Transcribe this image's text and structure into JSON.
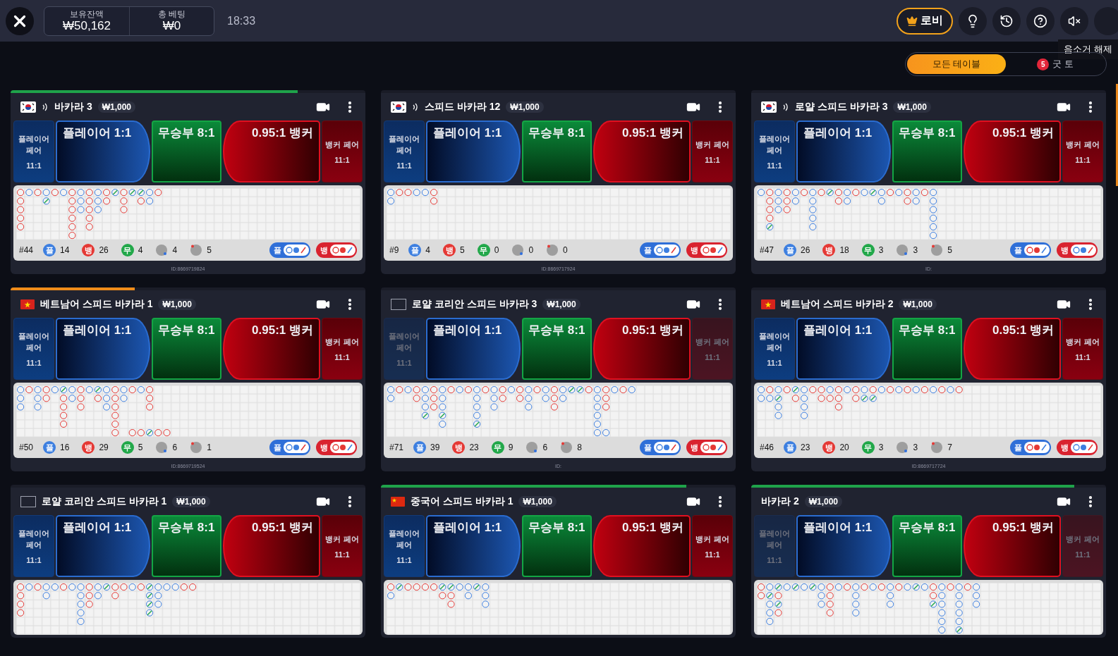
{
  "top_bar": {
    "balance": {
      "label": "보유잔액",
      "value": "₩50,162"
    },
    "total_bet": {
      "label": "총 베팅",
      "value": "₩0"
    },
    "time": "18:33",
    "lobby": "로비",
    "tooltip": "음소거 해제"
  },
  "filter_tabs": [
    {
      "label": "모든 테이블",
      "selected": true
    },
    {
      "label": "굿 토",
      "selected": false,
      "badge": "5"
    }
  ],
  "cards": [
    {
      "flag": {
        "kind": "kr"
      },
      "sound": true,
      "title": "바카라 3",
      "min_bet": "₩1,000",
      "progress": {
        "level": 0.81,
        "color": "#1fa34a"
      },
      "pairs_disabled": false,
      "bets": {
        "player_pair": "플레이어 페어",
        "player_pair_odds": "11:1",
        "player": "플레이어 1:1",
        "tie": "무승부 8:1",
        "banker": "0.95:1 뱅커",
        "banker_pair": "뱅커 페어",
        "banker_pair_odds": "11:1"
      },
      "road": [
        [
          {
            "kind": "b"
          },
          {
            "kind": "b"
          },
          {
            "kind": "b"
          },
          {
            "kind": "b"
          },
          {
            "kind": "b"
          }
        ],
        [
          {
            "kind": "p"
          }
        ],
        [
          {
            "kind": "b"
          }
        ],
        [
          {
            "kind": "p"
          },
          {
            "kind": "t"
          }
        ],
        [
          {
            "kind": "b"
          }
        ],
        [
          {
            "kind": "p"
          }
        ],
        [
          {
            "kind": "b"
          },
          {
            "kind": "b"
          },
          {
            "kind": "b"
          },
          {
            "kind": "b"
          },
          {
            "kind": "b"
          },
          {
            "kind": "b"
          }
        ],
        [
          {
            "kind": "p"
          },
          {
            "kind": "p"
          },
          {
            "kind": "p"
          }
        ],
        [
          {
            "kind": "b"
          },
          {
            "kind": "b"
          },
          {
            "kind": "b"
          },
          {
            "kind": "b"
          },
          {
            "kind": "b"
          }
        ],
        [
          {
            "kind": "p"
          },
          {
            "kind": "p"
          },
          {
            "kind": "p"
          }
        ],
        [
          {
            "kind": "b"
          },
          {
            "kind": "b"
          }
        ],
        [
          {
            "kind": "t"
          }
        ],
        [
          {
            "kind": "b"
          },
          {
            "kind": "b"
          },
          {
            "kind": "b"
          }
        ],
        [
          {
            "kind": "t"
          }
        ],
        [
          {
            "kind": "t"
          },
          {
            "kind": "b"
          }
        ],
        [
          {
            "kind": "p"
          },
          {
            "kind": "p"
          }
        ],
        [
          {
            "kind": "b"
          }
        ]
      ],
      "stats": {
        "round": "#44",
        "player": {
          "label": "플",
          "count": "14"
        },
        "banker": {
          "label": "뱅",
          "count": "26"
        },
        "tie": {
          "label": "무",
          "count": "4"
        },
        "player_pair": "4",
        "banker_pair": "5"
      },
      "toggles": [
        {
          "label": "플",
          "kind": "player"
        },
        {
          "label": "뱅",
          "kind": "banker"
        }
      ],
      "id": "ID:8669719824"
    },
    {
      "flag": {
        "kind": "kr"
      },
      "sound": true,
      "title": "스피드 바카라 12",
      "min_bet": "₩1,000",
      "pairs_disabled": false,
      "bets": {
        "player_pair": "플레이어 페어",
        "player_pair_odds": "11:1",
        "player": "플레이어 1:1",
        "tie": "무승부 8:1",
        "banker": "0.95:1 뱅커",
        "banker_pair": "뱅커 페어",
        "banker_pair_odds": "11:1"
      },
      "road": [
        [
          {
            "kind": "p"
          },
          {
            "kind": "p"
          }
        ],
        [
          {
            "kind": "b"
          }
        ],
        [
          {
            "kind": "b"
          }
        ],
        [
          {
            "kind": "p"
          }
        ],
        [
          {
            "kind": "p"
          }
        ],
        [
          {
            "kind": "b"
          },
          {
            "kind": "b"
          }
        ]
      ],
      "stats": {
        "round": "#9",
        "player": {
          "label": "플",
          "count": "4"
        },
        "banker": {
          "label": "뱅",
          "count": "5"
        },
        "tie": {
          "label": "무",
          "count": "0"
        },
        "player_pair": "0",
        "banker_pair": "0"
      },
      "toggles": [
        {
          "label": "플",
          "kind": "player"
        },
        {
          "label": "뱅",
          "kind": "banker"
        }
      ],
      "id": "ID:8669717924"
    },
    {
      "flag": {
        "kind": "kr"
      },
      "sound": true,
      "title": "로얄 스피드 바카라 3",
      "min_bet": "₩1,000",
      "pairs_disabled": false,
      "bets": {
        "player_pair": "플레이어 페어",
        "player_pair_odds": "11:1",
        "player": "플레이어 1:1",
        "tie": "무승부 8:1",
        "banker": "0.95:1 뱅커",
        "banker_pair": "뱅커 페어",
        "banker_pair_odds": "11:1"
      },
      "road": [
        [
          {
            "kind": "p"
          }
        ],
        [
          {
            "kind": "b"
          },
          {
            "kind": "b"
          },
          {
            "kind": "b"
          },
          {
            "kind": "b"
          },
          {
            "kind": "t"
          }
        ],
        [
          {
            "kind": "p"
          },
          {
            "kind": "p"
          },
          {
            "kind": "p"
          }
        ],
        [
          {
            "kind": "b"
          },
          {
            "kind": "b"
          },
          {
            "kind": "b"
          }
        ],
        [
          {
            "kind": "p"
          },
          {
            "kind": "p"
          }
        ],
        [
          {
            "kind": "b"
          }
        ],
        [
          {
            "kind": "p"
          },
          {
            "kind": "p"
          },
          {
            "kind": "p"
          },
          {
            "kind": "p"
          },
          {
            "kind": "p"
          }
        ],
        [
          {
            "kind": "b"
          }
        ],
        [
          {
            "kind": "t"
          }
        ],
        [
          {
            "kind": "b"
          },
          {
            "kind": "b"
          }
        ],
        [
          {
            "kind": "p"
          },
          {
            "kind": "p"
          }
        ],
        [
          {
            "kind": "b"
          }
        ],
        [
          {
            "kind": "p"
          }
        ],
        [
          {
            "kind": "t"
          }
        ],
        [
          {
            "kind": "p"
          },
          {
            "kind": "p"
          }
        ],
        [
          {
            "kind": "b"
          }
        ],
        [
          {
            "kind": "p"
          }
        ],
        [
          {
            "kind": "b"
          },
          {
            "kind": "b"
          }
        ],
        [
          {
            "kind": "p"
          },
          {
            "kind": "p"
          }
        ],
        [
          {
            "kind": "b"
          }
        ],
        [
          {
            "kind": "p"
          },
          {
            "kind": "p"
          },
          {
            "kind": "p"
          },
          {
            "kind": "p"
          },
          {
            "kind": "p"
          },
          {
            "kind": "p"
          }
        ]
      ],
      "stats": {
        "round": "#47",
        "player": {
          "label": "플",
          "count": "26"
        },
        "banker": {
          "label": "뱅",
          "count": "18"
        },
        "tie": {
          "label": "무",
          "count": "3"
        },
        "player_pair": "3",
        "banker_pair": "5"
      },
      "toggles": [
        {
          "label": "플",
          "kind": "banker"
        },
        {
          "label": "뱅",
          "kind": "player"
        }
      ],
      "id": "ID:"
    },
    {
      "flag": {
        "kind": "vn"
      },
      "sound": false,
      "title": "베트남어 스피드 바카라 1",
      "min_bet": "₩1,000",
      "progress": {
        "level": 0.35,
        "color": "#f08c1a"
      },
      "pairs_disabled": false,
      "bets": {
        "player_pair": "플레이어 페어",
        "player_pair_odds": "11:1",
        "player": "플레이어 1:1",
        "tie": "무승부 8:1",
        "banker": "0.95:1 뱅커",
        "banker_pair": "뱅커 페어",
        "banker_pair_odds": "11:1"
      },
      "road": [
        [
          {
            "kind": "p"
          },
          {
            "kind": "p"
          },
          {
            "kind": "p"
          }
        ],
        [
          {
            "kind": "b"
          }
        ],
        [
          {
            "kind": "p"
          },
          {
            "kind": "p"
          },
          {
            "kind": "p"
          }
        ],
        [
          {
            "kind": "b"
          },
          {
            "kind": "b"
          }
        ],
        [
          {
            "kind": "p"
          }
        ],
        [
          {
            "kind": "t"
          },
          {
            "kind": "b"
          },
          {
            "kind": "b"
          },
          {
            "kind": "b"
          },
          {
            "kind": "b"
          }
        ],
        [
          {
            "kind": "p"
          },
          {
            "kind": "p"
          }
        ],
        [
          {
            "kind": "b"
          },
          {
            "kind": "b"
          },
          {
            "kind": "b"
          }
        ],
        [
          {
            "kind": "p"
          }
        ],
        [
          {
            "kind": "t"
          },
          {
            "kind": "b"
          }
        ],
        [
          {
            "kind": "p"
          },
          {
            "kind": "p"
          },
          {
            "kind": "p"
          }
        ],
        [
          {
            "kind": "b"
          },
          {
            "kind": "b"
          },
          {
            "kind": "b"
          },
          {
            "kind": "b"
          },
          {
            "kind": "b"
          },
          {
            "kind": "b"
          }
        ],
        [
          {
            "kind": "p"
          },
          {
            "kind": "p"
          }
        ],
        [
          {
            "kind": "b"
          },
          {
            "kind": "null"
          },
          {
            "kind": "null"
          },
          {
            "kind": "null"
          },
          {
            "kind": "null"
          },
          {
            "kind": "b"
          }
        ],
        [
          {
            "kind": "p"
          },
          {
            "kind": "null"
          },
          {
            "kind": "null"
          },
          {
            "kind": "null"
          },
          {
            "kind": "null"
          },
          {
            "kind": "b"
          }
        ],
        [
          {
            "kind": "b"
          },
          {
            "kind": "b"
          },
          {
            "kind": "b"
          },
          {
            "kind": "null"
          },
          {
            "kind": "null"
          },
          {
            "kind": "t"
          }
        ],
        [
          {
            "kind": "null"
          },
          {
            "kind": "null"
          },
          {
            "kind": "null"
          },
          {
            "kind": "null"
          },
          {
            "kind": "null"
          },
          {
            "kind": "b"
          }
        ],
        [
          {
            "kind": "null"
          },
          {
            "kind": "null"
          },
          {
            "kind": "null"
          },
          {
            "kind": "null"
          },
          {
            "kind": "null"
          },
          {
            "kind": "b"
          }
        ]
      ],
      "stats": {
        "round": "#50",
        "player": {
          "label": "플",
          "count": "16"
        },
        "banker": {
          "label": "뱅",
          "count": "29"
        },
        "tie": {
          "label": "무",
          "count": "5"
        },
        "player_pair": "6",
        "banker_pair": "1"
      },
      "toggles": [
        {
          "label": "플",
          "kind": "player"
        },
        {
          "label": "뱅",
          "kind": "banker"
        }
      ],
      "id": "ID:8669719524"
    },
    {
      "flag": {
        "kind": "blank"
      },
      "sound": false,
      "title": "로얄 코리안 스피드 바카라 3",
      "min_bet": "₩1,000",
      "pairs_disabled": true,
      "bets": {
        "player_pair": "플레이어 페어",
        "player_pair_odds": "11:1",
        "player": "플레이어 1:1",
        "tie": "무승부 8:1",
        "banker": "0.95:1 뱅커",
        "banker_pair": "뱅커 페어",
        "banker_pair_odds": "11:1"
      },
      "road": [
        [
          {
            "kind": "p"
          },
          {
            "kind": "p"
          }
        ],
        [
          {
            "kind": "b"
          }
        ],
        [
          {
            "kind": "p"
          }
        ],
        [
          {
            "kind": "b"
          },
          {
            "kind": "b"
          }
        ],
        [
          {
            "kind": "p"
          },
          {
            "kind": "p"
          },
          {
            "kind": "p"
          },
          {
            "kind": "t"
          }
        ],
        [
          {
            "kind": "b"
          },
          {
            "kind": "b"
          },
          {
            "kind": "b"
          }
        ],
        [
          {
            "kind": "p"
          },
          {
            "kind": "p"
          },
          {
            "kind": "p"
          },
          {
            "kind": "t"
          },
          {
            "kind": "p"
          }
        ],
        [
          {
            "kind": "b"
          }
        ],
        [
          {
            "kind": "p"
          }
        ],
        [
          {
            "kind": "b"
          }
        ],
        [
          {
            "kind": "p"
          },
          {
            "kind": "p"
          },
          {
            "kind": "p"
          },
          {
            "kind": "p"
          },
          {
            "kind": "t"
          }
        ],
        [
          {
            "kind": "b"
          }
        ],
        [
          {
            "kind": "p"
          },
          {
            "kind": "p"
          },
          {
            "kind": "p"
          }
        ],
        [
          {
            "kind": "b"
          },
          {
            "kind": "b"
          }
        ],
        [
          {
            "kind": "p"
          }
        ],
        [
          {
            "kind": "b"
          },
          {
            "kind": "b"
          }
        ],
        [
          {
            "kind": "p"
          },
          {
            "kind": "p"
          },
          {
            "kind": "p"
          }
        ],
        [
          {
            "kind": "b"
          }
        ],
        [
          {
            "kind": "p"
          },
          {
            "kind": "p"
          }
        ],
        [
          {
            "kind": "b"
          },
          {
            "kind": "b"
          },
          {
            "kind": "b"
          }
        ],
        [
          {
            "kind": "p"
          },
          {
            "kind": "p"
          }
        ],
        [
          {
            "kind": "t"
          }
        ],
        [
          {
            "kind": "t"
          }
        ],
        [
          {
            "kind": "b"
          }
        ],
        [
          {
            "kind": "p"
          },
          {
            "kind": "p"
          },
          {
            "kind": "p"
          },
          {
            "kind": "p"
          },
          {
            "kind": "p"
          },
          {
            "kind": "p"
          }
        ],
        [
          {
            "kind": "b"
          },
          {
            "kind": "b"
          },
          {
            "kind": "b"
          },
          {
            "kind": "null"
          },
          {
            "kind": "null"
          },
          {
            "kind": "p"
          }
        ],
        [
          {
            "kind": "p"
          }
        ],
        [
          {
            "kind": "b"
          }
        ],
        [
          {
            "kind": "p"
          }
        ]
      ],
      "stats": {
        "round": "#71",
        "player": {
          "label": "플",
          "count": "39"
        },
        "banker": {
          "label": "뱅",
          "count": "23"
        },
        "tie": {
          "label": "무",
          "count": "9"
        },
        "player_pair": "6",
        "banker_pair": "8"
      },
      "toggles": [
        {
          "label": "플",
          "kind": "player"
        },
        {
          "label": "뱅",
          "kind": "banker"
        }
      ],
      "id": "ID:"
    },
    {
      "flag": {
        "kind": "vn"
      },
      "sound": false,
      "title": "베트남어 스피드 바카라 2",
      "min_bet": "₩1,000",
      "pairs_disabled": false,
      "bets": {
        "player_pair": "플레이어 페어",
        "player_pair_odds": "11:1",
        "player": "플레이어 1:1",
        "tie": "무승부 8:1",
        "banker": "0.95:1 뱅커",
        "banker_pair": "뱅커 페어",
        "banker_pair_odds": "11:1"
      },
      "road": [
        [
          {
            "kind": "p"
          },
          {
            "kind": "p"
          }
        ],
        [
          {
            "kind": "b"
          },
          {
            "kind": "p"
          }
        ],
        [
          {
            "kind": "p"
          },
          {
            "kind": "t"
          },
          {
            "kind": "p"
          },
          {
            "kind": "p"
          }
        ],
        [
          {
            "kind": "b"
          }
        ],
        [
          {
            "kind": "t"
          },
          {
            "kind": "b"
          }
        ],
        [
          {
            "kind": "p"
          },
          {
            "kind": "p"
          },
          {
            "kind": "p"
          },
          {
            "kind": "p"
          }
        ],
        [
          {
            "kind": "b"
          }
        ],
        [
          {
            "kind": "b"
          },
          {
            "kind": "b"
          }
        ],
        [
          {
            "kind": "p"
          },
          {
            "kind": "b"
          }
        ],
        [
          {
            "kind": "b"
          },
          {
            "kind": "b"
          },
          {
            "kind": "b"
          }
        ],
        [
          {
            "kind": "p"
          }
        ],
        [
          {
            "kind": "b"
          },
          {
            "kind": "b"
          }
        ],
        [
          {
            "kind": "p"
          },
          {
            "kind": "t"
          }
        ],
        [
          {
            "kind": "b"
          },
          {
            "kind": "t"
          }
        ],
        [
          {
            "kind": "p"
          }
        ],
        [
          {
            "kind": "b"
          }
        ],
        [
          {
            "kind": "p"
          }
        ],
        [
          {
            "kind": "b"
          }
        ],
        [
          {
            "kind": "p"
          }
        ],
        [
          {
            "kind": "b"
          }
        ],
        [
          {
            "kind": "p"
          }
        ],
        [
          {
            "kind": "b"
          }
        ],
        [
          {
            "kind": "p"
          }
        ],
        [
          {
            "kind": "b"
          }
        ]
      ],
      "stats": {
        "round": "#46",
        "player": {
          "label": "플",
          "count": "23"
        },
        "banker": {
          "label": "뱅",
          "count": "20"
        },
        "tie": {
          "label": "무",
          "count": "3"
        },
        "player_pair": "3",
        "banker_pair": "7"
      },
      "toggles": [
        {
          "label": "플",
          "kind": "banker"
        },
        {
          "label": "뱅",
          "kind": "player"
        }
      ],
      "id": "ID:8669717724"
    },
    {
      "flag": {
        "kind": "blank"
      },
      "sound": false,
      "title": "로얄 코리안 스피드 바카라 1",
      "min_bet": "₩1,000",
      "pairs_disabled": false,
      "bets": {
        "player_pair": "플레이어 페어",
        "player_pair_odds": "11:1",
        "player": "플레이어 1:1",
        "tie": "무승부 8:1",
        "banker": "0.95:1 뱅커",
        "banker_pair": "뱅커 페어",
        "banker_pair_odds": "11:1"
      },
      "road": [
        [
          {
            "kind": "b"
          },
          {
            "kind": "b"
          },
          {
            "kind": "b"
          },
          {
            "kind": "b"
          }
        ],
        [
          {
            "kind": "p"
          }
        ],
        [
          {
            "kind": "b"
          }
        ],
        [
          {
            "kind": "p"
          },
          {
            "kind": "p"
          }
        ],
        [
          {
            "kind": "p"
          }
        ],
        [
          {
            "kind": "b"
          }
        ],
        [
          {
            "kind": "p"
          }
        ],
        [
          {
            "kind": "p"
          },
          {
            "kind": "p"
          },
          {
            "kind": "p"
          },
          {
            "kind": "p"
          },
          {
            "kind": "p"
          }
        ],
        [
          {
            "kind": "b"
          },
          {
            "kind": "b"
          },
          {
            "kind": "b"
          }
        ],
        [
          {
            "kind": "p"
          },
          {
            "kind": "p"
          }
        ],
        [
          {
            "kind": "t"
          }
        ],
        [
          {
            "kind": "b"
          },
          {
            "kind": "b"
          }
        ],
        [
          {
            "kind": "b"
          }
        ],
        [
          {
            "kind": "p"
          }
        ],
        [
          {
            "kind": "b"
          }
        ],
        [
          {
            "kind": "t"
          },
          {
            "kind": "t"
          },
          {
            "kind": "t"
          },
          {
            "kind": "t"
          }
        ],
        [
          {
            "kind": "p"
          },
          {
            "kind": "p"
          },
          {
            "kind": "p"
          }
        ],
        [
          {
            "kind": "p"
          }
        ],
        [
          {
            "kind": "p"
          }
        ],
        [
          {
            "kind": "b"
          }
        ],
        [
          {
            "kind": "b"
          }
        ]
      ]
    },
    {
      "flag": {
        "kind": "cn"
      },
      "sound": false,
      "title": "중국어 스피드 바카라 1",
      "min_bet": "₩1,000",
      "progress": {
        "level": 0.86,
        "color": "#1fa34a"
      },
      "pairs_disabled": false,
      "bets": {
        "player_pair": "플레이어 페어",
        "player_pair_odds": "11:1",
        "player": "플레이어 1:1",
        "tie": "무승부 8:1",
        "banker": "0.95:1 뱅커",
        "banker_pair": "뱅커 페어",
        "banker_pair_odds": "11:1"
      },
      "road": [
        [
          {
            "kind": "b"
          },
          {
            "kind": "p"
          }
        ],
        [
          {
            "kind": "t"
          }
        ],
        [
          {
            "kind": "b"
          }
        ],
        [
          {
            "kind": "b"
          }
        ],
        [
          {
            "kind": "b"
          }
        ],
        [
          {
            "kind": "b"
          }
        ],
        [
          {
            "kind": "t"
          },
          {
            "kind": "b"
          }
        ],
        [
          {
            "kind": "t"
          },
          {
            "kind": "b"
          },
          {
            "kind": "b"
          }
        ],
        [
          {
            "kind": "p"
          }
        ],
        [
          {
            "kind": "p"
          },
          {
            "kind": "p"
          }
        ],
        [
          {
            "kind": "t"
          }
        ],
        [
          {
            "kind": "p"
          },
          {
            "kind": "p"
          },
          {
            "kind": "p"
          }
        ]
      ]
    },
    {
      "flag": {
        "kind": "none"
      },
      "sound": false,
      "title": "바카라 2",
      "min_bet": "₩1,000",
      "progress": {
        "level": 0.91,
        "color": "#1fa34a"
      },
      "pairs_disabled": true,
      "bets": {
        "player_pair": "플레이어 페어",
        "player_pair_odds": "11:1",
        "player": "플레이어 1:1",
        "tie": "무승부 8:1",
        "banker": "0.95:1 뱅커",
        "banker_pair": "뱅커 페어",
        "banker_pair_odds": "11:1"
      },
      "road": [
        [
          {
            "kind": "b"
          },
          {
            "kind": "b"
          }
        ],
        [
          {
            "kind": "p"
          },
          {
            "kind": "t"
          },
          {
            "kind": "p"
          },
          {
            "kind": "p"
          },
          {
            "kind": "p"
          }
        ],
        [
          {
            "kind": "t"
          },
          {
            "kind": "b"
          },
          {
            "kind": "t"
          },
          {
            "kind": "b"
          }
        ],
        [
          {
            "kind": "p"
          }
        ],
        [
          {
            "kind": "t"
          }
        ],
        [
          {
            "kind": "p"
          }
        ],
        [
          {
            "kind": "t"
          }
        ],
        [
          {
            "kind": "p"
          },
          {
            "kind": "p"
          },
          {
            "kind": "p"
          }
        ],
        [
          {
            "kind": "b"
          },
          {
            "kind": "b"
          },
          {
            "kind": "b"
          },
          {
            "kind": "b"
          }
        ],
        [
          {
            "kind": "p"
          }
        ],
        [
          {
            "kind": "b"
          }
        ],
        [
          {
            "kind": "p"
          },
          {
            "kind": "p"
          },
          {
            "kind": "p"
          },
          {
            "kind": "p"
          }
        ],
        [
          {
            "kind": "b"
          }
        ],
        [
          {
            "kind": "p"
          }
        ],
        [
          {
            "kind": "b"
          }
        ],
        [
          {
            "kind": "p"
          },
          {
            "kind": "p"
          },
          {
            "kind": "p"
          }
        ],
        [
          {
            "kind": "b"
          }
        ],
        [
          {
            "kind": "p"
          }
        ],
        [
          {
            "kind": "t"
          }
        ],
        [
          {
            "kind": "p"
          }
        ],
        [
          {
            "kind": "b"
          },
          {
            "kind": "b"
          },
          {
            "kind": "t"
          }
        ],
        [
          {
            "kind": "p"
          },
          {
            "kind": "p"
          },
          {
            "kind": "p"
          },
          {
            "kind": "p"
          },
          {
            "kind": "p"
          },
          {
            "kind": "p"
          }
        ],
        [
          {
            "kind": "b"
          }
        ],
        [
          {
            "kind": "p"
          },
          {
            "kind": "p"
          },
          {
            "kind": "p"
          },
          {
            "kind": "p"
          },
          {
            "kind": "p"
          },
          {
            "kind": "t"
          }
        ],
        [
          {
            "kind": "b"
          }
        ],
        [
          {
            "kind": "p"
          },
          {
            "kind": "p"
          },
          {
            "kind": "p"
          }
        ]
      ]
    }
  ]
}
